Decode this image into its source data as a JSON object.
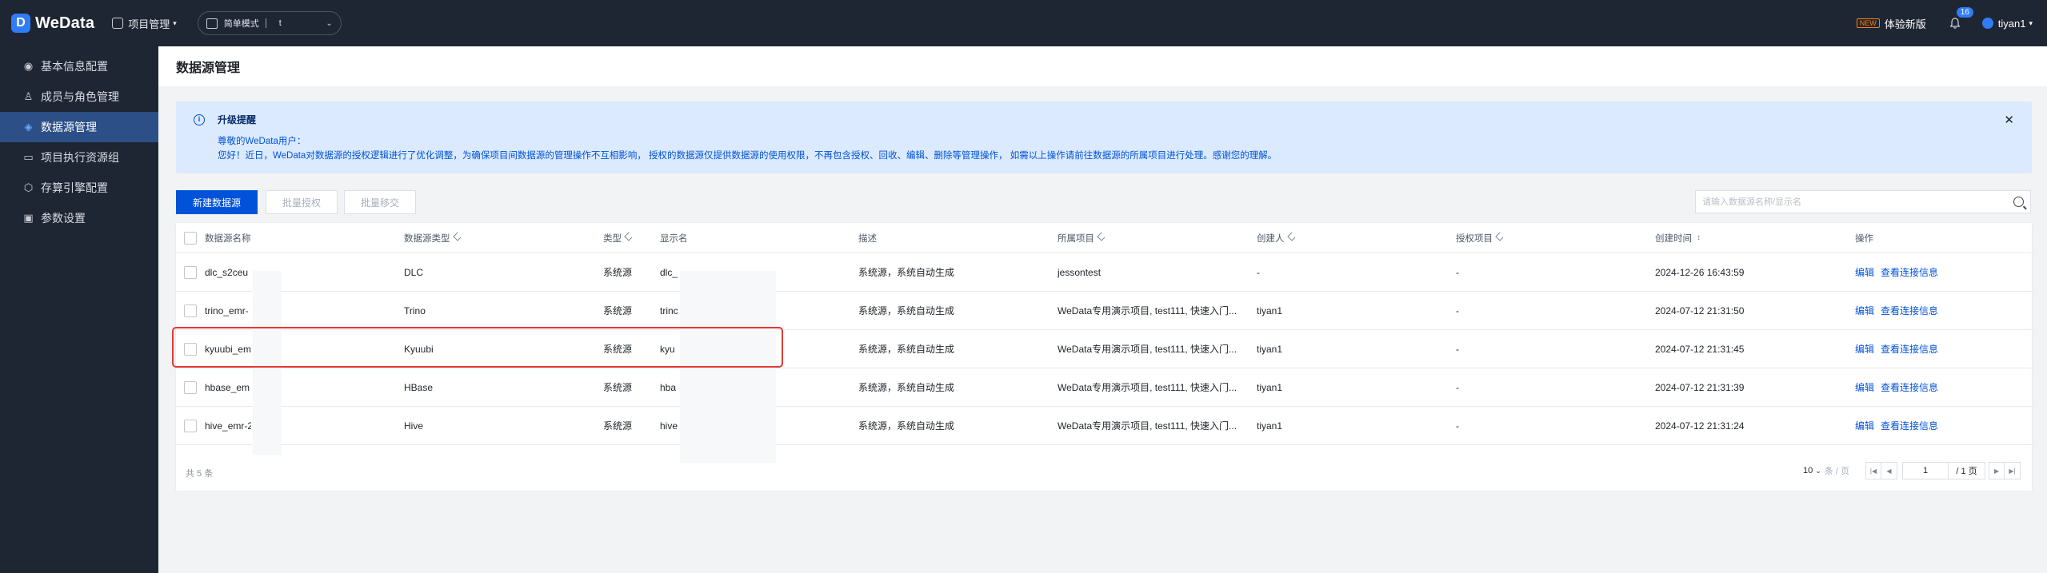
{
  "app": {
    "logo_letter": "D",
    "name": "WeData",
    "project_menu": "项目管理",
    "mode_label": "简单模式",
    "mode_value": "t"
  },
  "topbar": {
    "new_tag": "NEW",
    "experience_label": "体验新版",
    "notif_count": "16",
    "username": "tiyan1"
  },
  "sidebar": {
    "items": [
      {
        "icon": "dashboard-icon",
        "glyph": "◉",
        "label": "基本信息配置",
        "active": false
      },
      {
        "icon": "user-icon",
        "glyph": "♙",
        "label": "成员与角色管理",
        "active": false
      },
      {
        "icon": "datasource-icon",
        "glyph": "◈",
        "label": "数据源管理",
        "active": true
      },
      {
        "icon": "resource-group-icon",
        "glyph": "▭",
        "label": "项目执行资源组",
        "active": false
      },
      {
        "icon": "engine-icon",
        "glyph": "⬡",
        "label": "存算引擎配置",
        "active": false
      },
      {
        "icon": "param-icon",
        "glyph": "▣",
        "label": "参数设置",
        "active": false
      }
    ]
  },
  "page": {
    "title": "数据源管理"
  },
  "notice": {
    "title": "升级提醒",
    "greeting": "尊敬的WeData用户：",
    "body": "您好！近日，WeData对数据源的授权逻辑进行了优化调整，为确保项目间数据源的管理操作不互相影响， 授权的数据源仅提供数据源的使用权限，不再包含授权、回收、编辑、删除等管理操作， 如需以上操作请前往数据源的所属项目进行处理。感谢您的理解。"
  },
  "toolbar": {
    "create_label": "新建数据源",
    "batch_auth_label": "批量授权",
    "batch_transfer_label": "批量移交",
    "search_placeholder": "请输入数据源名称/显示名"
  },
  "table": {
    "headers": {
      "name": "数据源名称",
      "ds_type": "数据源类型",
      "kind": "类型",
      "display": "显示名",
      "desc": "描述",
      "project": "所属项目",
      "creator": "创建人",
      "auth_project": "授权项目",
      "created": "创建时间",
      "ops": "操作"
    },
    "rows": [
      {
        "name": "dlc_s2ceu",
        "ds_type": "DLC",
        "kind": "系统源",
        "display": "dlc_",
        "desc": "系统源，系统自动生成",
        "project": "jessontest",
        "creator": "-",
        "auth_project": "-",
        "created": "2024-12-26 16:43:59",
        "edit": "编辑",
        "view": "查看连接信息"
      },
      {
        "name": "trino_emr-",
        "ds_type": "Trino",
        "kind": "系统源",
        "display": "trinc",
        "desc": "系统源，系统自动生成",
        "project": "WeData专用演示项目, test111, 快速入门...",
        "creator": "tiyan1",
        "auth_project": "-",
        "created": "2024-07-12 21:31:50",
        "edit": "编辑",
        "view": "查看连接信息"
      },
      {
        "name": "kyuubi_em",
        "ds_type": "Kyuubi",
        "kind": "系统源",
        "display": "kyu",
        "desc": "系统源，系统自动生成",
        "project": "WeData专用演示项目, test111, 快速入门...",
        "creator": "tiyan1",
        "auth_project": "-",
        "created": "2024-07-12 21:31:45",
        "edit": "编辑",
        "view": "查看连接信息"
      },
      {
        "name": "hbase_em",
        "ds_type": "HBase",
        "kind": "系统源",
        "display": "hba",
        "desc": "系统源，系统自动生成",
        "project": "WeData专用演示项目, test111, 快速入门...",
        "creator": "tiyan1",
        "auth_project": "-",
        "created": "2024-07-12 21:31:39",
        "edit": "编辑",
        "view": "查看连接信息"
      },
      {
        "name": "hive_emr-2",
        "ds_type": "Hive",
        "kind": "系统源",
        "display": "hive",
        "desc": "系统源，系统自动生成",
        "project": "WeData专用演示项目, test111, 快速入门...",
        "creator": "tiyan1",
        "auth_project": "-",
        "created": "2024-07-12 21:31:24",
        "edit": "编辑",
        "view": "查看连接信息"
      }
    ]
  },
  "pagination": {
    "total": "共 5 条",
    "page_size": "10",
    "page_size_unit": "条 / 页",
    "current_page": "1",
    "total_pages": "/ 1 页"
  }
}
